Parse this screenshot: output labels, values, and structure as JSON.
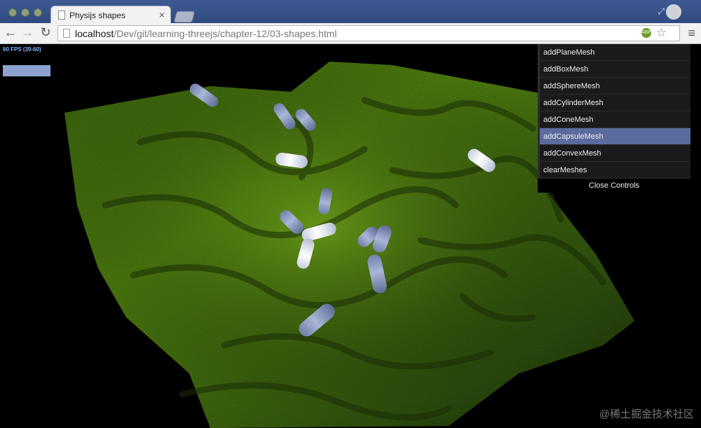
{
  "browser": {
    "tab_title": "Physijs shapes",
    "tab_close": "×",
    "url_host": "localhost",
    "url_path": "/Dev/git/learning-threejs/chapter-12/03-shapes.html",
    "nav_back": "←",
    "nav_forward": "→",
    "nav_reload": "↻",
    "star": "☆",
    "menu": "≡",
    "ext_badge": "ABP"
  },
  "stats": {
    "fps_text": "60 FPS (39-60)"
  },
  "controls": {
    "items": [
      {
        "label": "addPlaneMesh"
      },
      {
        "label": "addBoxMesh"
      },
      {
        "label": "addSphereMesh"
      },
      {
        "label": "addCylinderMesh"
      },
      {
        "label": "addConeMesh"
      },
      {
        "label": "addCapsuleMesh"
      },
      {
        "label": "addConvexMesh"
      },
      {
        "label": "clearMeshes"
      }
    ],
    "active_index": 5,
    "close_label": "Close Controls"
  },
  "watermark": "@稀土掘金技术社区",
  "colors": {
    "terrain": "#4a7a12",
    "capsule": "#8c9cc8",
    "capsule_highlight": "#e8ecf5",
    "gui_active": "#5b6b9e"
  }
}
